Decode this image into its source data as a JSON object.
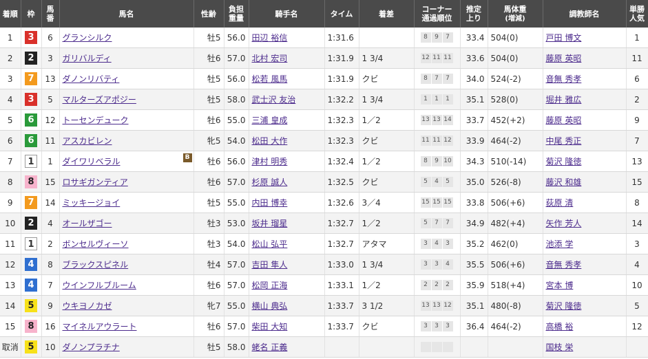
{
  "headers": {
    "rank": "着順",
    "waku": "枠",
    "umaban_1": "馬",
    "umaban_2": "番",
    "horse": "馬名",
    "sexage": "性齢",
    "weight_1": "負担",
    "weight_2": "重量",
    "jockey": "騎手名",
    "time": "タイム",
    "margin": "着差",
    "corner_1": "コーナー",
    "corner_2": "通過順位",
    "last3f_1": "推定",
    "last3f_2": "上り",
    "body_1": "馬体重",
    "body_2": "(増減)",
    "trainer": "調教師名",
    "pop_1": "単勝",
    "pop_2": "人気"
  },
  "rows": [
    {
      "rank": "1",
      "waku": "3",
      "umaban": "6",
      "horse": "グランシルク",
      "blinker": "",
      "sexage": "牡5",
      "weight": "56.0",
      "jockey": "田辺 裕信",
      "time": "1:31.6",
      "margin": "",
      "corners": [
        "8",
        "9",
        "7"
      ],
      "last3f": "33.4",
      "body": "504(0)",
      "trainer": "戸田 博文",
      "pop": "1"
    },
    {
      "rank": "2",
      "waku": "2",
      "umaban": "3",
      "horse": "ガリバルディ",
      "blinker": "",
      "sexage": "牡6",
      "weight": "57.0",
      "jockey": "北村 宏司",
      "time": "1:31.9",
      "margin": "1 3/4",
      "corners": [
        "12",
        "11",
        "11"
      ],
      "last3f": "33.6",
      "body": "504(0)",
      "trainer": "藤原 英昭",
      "pop": "11"
    },
    {
      "rank": "3",
      "waku": "7",
      "umaban": "13",
      "horse": "ダノンリバティ",
      "blinker": "",
      "sexage": "牡5",
      "weight": "56.0",
      "jockey": "松若 風馬",
      "time": "1:31.9",
      "margin": "クビ",
      "corners": [
        "8",
        "7",
        "7"
      ],
      "last3f": "34.0",
      "body": "524(-2)",
      "trainer": "音無 秀孝",
      "pop": "6"
    },
    {
      "rank": "4",
      "waku": "3",
      "umaban": "5",
      "horse": "マルターズアポジー",
      "blinker": "",
      "sexage": "牡5",
      "weight": "58.0",
      "jockey": "武士沢 友治",
      "time": "1:32.2",
      "margin": "1 3/4",
      "corners": [
        "1",
        "1",
        "1"
      ],
      "last3f": "35.1",
      "body": "528(0)",
      "trainer": "堀井 雅広",
      "pop": "2"
    },
    {
      "rank": "5",
      "waku": "6",
      "umaban": "12",
      "horse": "トーセンデューク",
      "blinker": "",
      "sexage": "牡6",
      "weight": "55.0",
      "jockey": "三浦 皇成",
      "time": "1:32.3",
      "margin": "1／2",
      "corners": [
        "13",
        "13",
        "14"
      ],
      "last3f": "33.7",
      "body": "452(+2)",
      "trainer": "藤原 英昭",
      "pop": "9"
    },
    {
      "rank": "6",
      "waku": "6",
      "umaban": "11",
      "horse": "アスカビレン",
      "blinker": "",
      "sexage": "牝5",
      "weight": "54.0",
      "jockey": "松田 大作",
      "time": "1:32.3",
      "margin": "クビ",
      "corners": [
        "11",
        "11",
        "12"
      ],
      "last3f": "33.9",
      "body": "464(-2)",
      "trainer": "中尾 秀正",
      "pop": "7"
    },
    {
      "rank": "7",
      "waku": "1",
      "umaban": "1",
      "horse": "ダイワリベラル",
      "blinker": "B",
      "sexage": "牡6",
      "weight": "56.0",
      "jockey": "津村 明秀",
      "time": "1:32.4",
      "margin": "1／2",
      "corners": [
        "8",
        "9",
        "10"
      ],
      "last3f": "34.3",
      "body": "510(-14)",
      "trainer": "菊沢 隆徳",
      "pop": "13"
    },
    {
      "rank": "8",
      "waku": "8",
      "umaban": "15",
      "horse": "ロサギガンティア",
      "blinker": "",
      "sexage": "牡6",
      "weight": "57.0",
      "jockey": "杉原 誠人",
      "time": "1:32.5",
      "margin": "クビ",
      "corners": [
        "5",
        "4",
        "5"
      ],
      "last3f": "35.0",
      "body": "526(-8)",
      "trainer": "藤沢 和雄",
      "pop": "15"
    },
    {
      "rank": "9",
      "waku": "7",
      "umaban": "14",
      "horse": "ミッキージョイ",
      "blinker": "",
      "sexage": "牡5",
      "weight": "55.0",
      "jockey": "内田 博幸",
      "time": "1:32.6",
      "margin": "3／4",
      "corners": [
        "15",
        "15",
        "15"
      ],
      "last3f": "33.8",
      "body": "506(+6)",
      "trainer": "荻原 清",
      "pop": "8"
    },
    {
      "rank": "10",
      "waku": "2",
      "umaban": "4",
      "horse": "オールザゴー",
      "blinker": "",
      "sexage": "牡3",
      "weight": "53.0",
      "jockey": "坂井 瑠星",
      "time": "1:32.7",
      "margin": "1／2",
      "corners": [
        "5",
        "7",
        "7"
      ],
      "last3f": "34.9",
      "body": "482(+4)",
      "trainer": "矢作 芳人",
      "pop": "14"
    },
    {
      "rank": "11",
      "waku": "1",
      "umaban": "2",
      "horse": "ボンセルヴィーソ",
      "blinker": "",
      "sexage": "牡3",
      "weight": "54.0",
      "jockey": "松山 弘平",
      "time": "1:32.7",
      "margin": "アタマ",
      "corners": [
        "3",
        "4",
        "3"
      ],
      "last3f": "35.2",
      "body": "462(0)",
      "trainer": "池添 学",
      "pop": "3"
    },
    {
      "rank": "12",
      "waku": "4",
      "umaban": "8",
      "horse": "ブラックスピネル",
      "blinker": "",
      "sexage": "牡4",
      "weight": "57.0",
      "jockey": "吉田 隼人",
      "time": "1:33.0",
      "margin": "1 3/4",
      "corners": [
        "3",
        "3",
        "4"
      ],
      "last3f": "35.5",
      "body": "506(+6)",
      "trainer": "音無 秀孝",
      "pop": "4"
    },
    {
      "rank": "13",
      "waku": "4",
      "umaban": "7",
      "horse": "ウインフルブルーム",
      "blinker": "",
      "sexage": "牡6",
      "weight": "57.0",
      "jockey": "松岡 正海",
      "time": "1:33.1",
      "margin": "1／2",
      "corners": [
        "2",
        "2",
        "2"
      ],
      "last3f": "35.9",
      "body": "518(+4)",
      "trainer": "宮本 博",
      "pop": "10"
    },
    {
      "rank": "14",
      "waku": "5",
      "umaban": "9",
      "horse": "ウキヨノカゼ",
      "blinker": "",
      "sexage": "牝7",
      "weight": "55.0",
      "jockey": "横山 典弘",
      "time": "1:33.7",
      "margin": "3 1/2",
      "corners": [
        "13",
        "13",
        "12"
      ],
      "last3f": "35.1",
      "body": "480(-8)",
      "trainer": "菊沢 隆徳",
      "pop": "5"
    },
    {
      "rank": "15",
      "waku": "8",
      "umaban": "16",
      "horse": "マイネルアウラート",
      "blinker": "",
      "sexage": "牡6",
      "weight": "57.0",
      "jockey": "柴田 大知",
      "time": "1:33.7",
      "margin": "クビ",
      "corners": [
        "3",
        "3",
        "3"
      ],
      "last3f": "36.4",
      "body": "464(-2)",
      "trainer": "高橋 裕",
      "pop": "12"
    },
    {
      "rank": "取消",
      "waku": "5",
      "umaban": "10",
      "horse": "ダノンプラチナ",
      "blinker": "",
      "sexage": "牡5",
      "weight": "58.0",
      "jockey": "蛯名 正義",
      "time": "",
      "margin": "",
      "corners": [
        "",
        "",
        ""
      ],
      "last3f": "",
      "body": "",
      "trainer": "国枝 栄",
      "pop": ""
    }
  ]
}
